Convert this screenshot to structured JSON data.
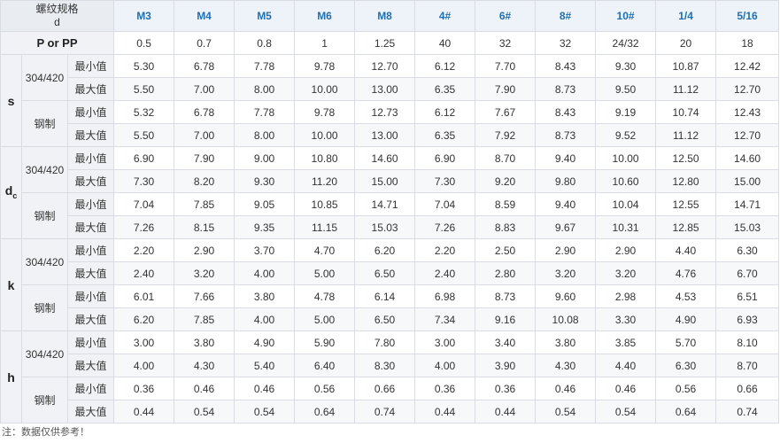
{
  "header": {
    "title_line1": "螺纹规格",
    "title_line2": "d",
    "sizes": [
      "M3",
      "M4",
      "M5",
      "M6",
      "M8",
      "4#",
      "6#",
      "8#",
      "10#",
      "1/4",
      "5/16"
    ]
  },
  "pitch": {
    "label": "P or PP",
    "values": [
      "0.5",
      "0.7",
      "0.8",
      "1",
      "1.25",
      "40",
      "32",
      "32",
      "24/32",
      "20",
      "18"
    ]
  },
  "params": [
    {
      "name": "s",
      "sub": "",
      "groups": [
        {
          "material": "304/420",
          "rows": [
            {
              "bound": "最小值",
              "values": [
                "5.30",
                "6.78",
                "7.78",
                "9.78",
                "12.70",
                "6.12",
                "7.70",
                "8.43",
                "9.30",
                "10.87",
                "12.42"
              ]
            },
            {
              "bound": "最大值",
              "values": [
                "5.50",
                "7.00",
                "8.00",
                "10.00",
                "13.00",
                "6.35",
                "7.90",
                "8.73",
                "9.50",
                "11.12",
                "12.70"
              ]
            }
          ]
        },
        {
          "material": "钢制",
          "rows": [
            {
              "bound": "最小值",
              "values": [
                "5.32",
                "6.78",
                "7.78",
                "9.78",
                "12.73",
                "6.12",
                "7.67",
                "8.43",
                "9.19",
                "10.74",
                "12.43"
              ]
            },
            {
              "bound": "最大值",
              "values": [
                "5.50",
                "7.00",
                "8.00",
                "10.00",
                "13.00",
                "6.35",
                "7.92",
                "8.73",
                "9.52",
                "11.12",
                "12.70"
              ]
            }
          ]
        }
      ]
    },
    {
      "name": "d",
      "sub": "c",
      "groups": [
        {
          "material": "304/420",
          "rows": [
            {
              "bound": "最小值",
              "values": [
                "6.90",
                "7.90",
                "9.00",
                "10.80",
                "14.60",
                "6.90",
                "8.70",
                "9.40",
                "10.00",
                "12.50",
                "14.60"
              ]
            },
            {
              "bound": "最大值",
              "values": [
                "7.30",
                "8.20",
                "9.30",
                "11.20",
                "15.00",
                "7.30",
                "9.20",
                "9.80",
                "10.60",
                "12.80",
                "15.00"
              ]
            }
          ]
        },
        {
          "material": "钢制",
          "rows": [
            {
              "bound": "最小值",
              "values": [
                "7.04",
                "7.85",
                "9.05",
                "10.85",
                "14.71",
                "7.04",
                "8.59",
                "9.40",
                "10.04",
                "12.55",
                "14.71"
              ]
            },
            {
              "bound": "最大值",
              "values": [
                "7.26",
                "8.15",
                "9.35",
                "11.15",
                "15.03",
                "7.26",
                "8.83",
                "9.67",
                "10.31",
                "12.85",
                "15.03"
              ]
            }
          ]
        }
      ]
    },
    {
      "name": "k",
      "sub": "",
      "groups": [
        {
          "material": "304/420",
          "rows": [
            {
              "bound": "最小值",
              "values": [
                "2.20",
                "2.90",
                "3.70",
                "4.70",
                "6.20",
                "2.20",
                "2.50",
                "2.90",
                "2.90",
                "4.40",
                "6.30"
              ]
            },
            {
              "bound": "最大值",
              "values": [
                "2.40",
                "3.20",
                "4.00",
                "5.00",
                "6.50",
                "2.40",
                "2.80",
                "3.20",
                "3.20",
                "4.76",
                "6.70"
              ]
            }
          ]
        },
        {
          "material": "钢制",
          "rows": [
            {
              "bound": "最小值",
              "values": [
                "6.01",
                "7.66",
                "3.80",
                "4.78",
                "6.14",
                "6.98",
                "8.73",
                "9.60",
                "2.98",
                "4.53",
                "6.51"
              ]
            },
            {
              "bound": "最大值",
              "values": [
                "6.20",
                "7.85",
                "4.00",
                "5.00",
                "6.50",
                "7.34",
                "9.16",
                "10.08",
                "3.30",
                "4.90",
                "6.93"
              ]
            }
          ]
        }
      ]
    },
    {
      "name": "h",
      "sub": "",
      "groups": [
        {
          "material": "304/420",
          "rows": [
            {
              "bound": "最小值",
              "values": [
                "3.00",
                "3.80",
                "4.90",
                "5.90",
                "7.80",
                "3.00",
                "3.40",
                "3.80",
                "3.85",
                "5.70",
                "8.10"
              ]
            },
            {
              "bound": "最大值",
              "values": [
                "4.00",
                "4.30",
                "5.40",
                "6.40",
                "8.30",
                "4.00",
                "3.90",
                "4.30",
                "4.40",
                "6.30",
                "8.70"
              ]
            }
          ]
        },
        {
          "material": "钢制",
          "rows": [
            {
              "bound": "最小值",
              "values": [
                "0.36",
                "0.46",
                "0.46",
                "0.56",
                "0.66",
                "0.36",
                "0.36",
                "0.46",
                "0.46",
                "0.56",
                "0.66"
              ]
            },
            {
              "bound": "最大值",
              "values": [
                "0.44",
                "0.54",
                "0.54",
                "0.64",
                "0.74",
                "0.44",
                "0.44",
                "0.54",
                "0.54",
                "0.64",
                "0.74"
              ]
            }
          ]
        }
      ]
    }
  ],
  "note": "注：数据仅供参考！"
}
